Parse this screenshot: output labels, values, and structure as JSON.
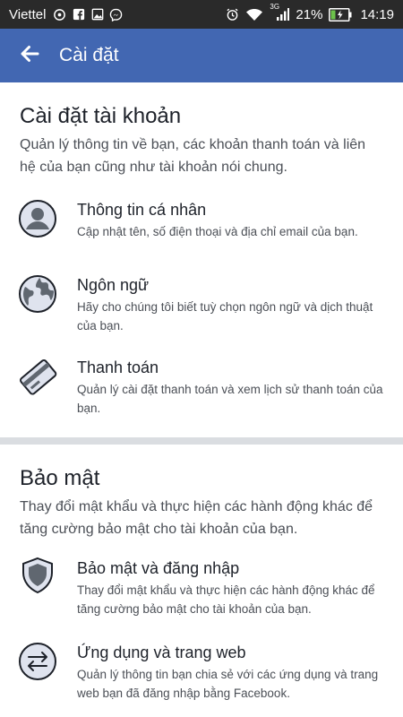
{
  "status_bar": {
    "carrier": "Viettel",
    "icons": [
      "hotspot-icon",
      "facebook-icon",
      "gallery-icon",
      "messenger-icon",
      "alarm-icon",
      "wifi-icon",
      "signal-3g-icon",
      "battery-charging-icon"
    ],
    "network": "3G",
    "battery_percent": "21%",
    "time": "14:19"
  },
  "app_bar": {
    "title": "Cài đặt",
    "color": "#4267b2"
  },
  "account_section": {
    "title": "Cài đặt tài khoản",
    "description": "Quản lý thông tin về bạn, các khoản thanh toán và liên hệ của bạn cũng như tài khoản nói chung.",
    "items": [
      {
        "icon": "person-icon",
        "title": "Thông tin cá nhân",
        "subtitle": "Cập nhật tên, số điện thoại và địa chỉ email của bạn."
      },
      {
        "icon": "globe-icon",
        "title": "Ngôn ngữ",
        "subtitle": "Hãy cho chúng tôi biết tuỳ chọn ngôn ngữ và dịch thuật của bạn."
      },
      {
        "icon": "credit-card-icon",
        "title": "Thanh toán",
        "subtitle": "Quản lý cài đặt thanh toán và xem lịch sử thanh toán của bạn."
      }
    ]
  },
  "security_section": {
    "title": "Bảo mật",
    "description": "Thay đổi mật khẩu và thực hiện các hành động khác để tăng cường bảo mật cho tài khoản của bạn.",
    "items": [
      {
        "icon": "shield-icon",
        "title": "Bảo mật và đăng nhập",
        "subtitle": "Thay đổi mật khẩu và thực hiện các hành động khác để tăng cường bảo mật cho tài khoản của bạn."
      },
      {
        "icon": "swap-arrows-icon",
        "title": "Ứng dụng và trang web",
        "subtitle": "Quản lý thông tin bạn chia sẻ với các ứng dụng và trang web bạn đã đăng nhập bằng Facebook."
      }
    ]
  }
}
